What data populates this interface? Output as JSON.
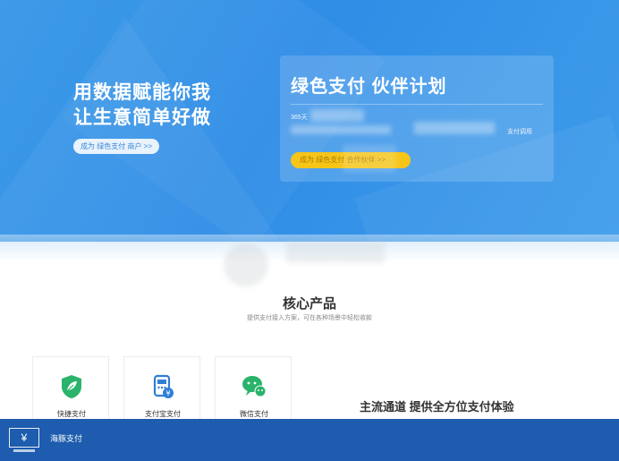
{
  "hero": {
    "slogan_line1": "用数据赋能你我",
    "slogan_line2": "让生意简单好做",
    "cta_small": "成为 绿色支付 商户 >>",
    "panel": {
      "title": "绿色支付 伙伴计划",
      "desc_prefix": "365天",
      "desc_suffix": "支付调用",
      "button": "成为 绿色支付 合作伙伴 >>"
    }
  },
  "core": {
    "title": "核心产品",
    "subtitle": "提供支付接入方案，可在各种场景中轻松收款"
  },
  "products": [
    {
      "label": "快捷支付",
      "icon": "shield-leaf-icon",
      "color": "#2bb36b"
    },
    {
      "label": "支付宝支付",
      "icon": "payment-terminal-icon",
      "color": "#2f7fd6"
    },
    {
      "label": "微信支付",
      "icon": "wechat-bubble-icon",
      "color": "#2bb36b"
    }
  ],
  "tagline": "主流通道 提供全方位支付体验",
  "footer": {
    "logo_symbol": "¥",
    "brand": "海豚支付"
  },
  "colors": {
    "hero_blue": "#2f8de6",
    "footer_blue": "#1d5cae",
    "button_yellow": "#f5c518",
    "green": "#2bb36b"
  }
}
